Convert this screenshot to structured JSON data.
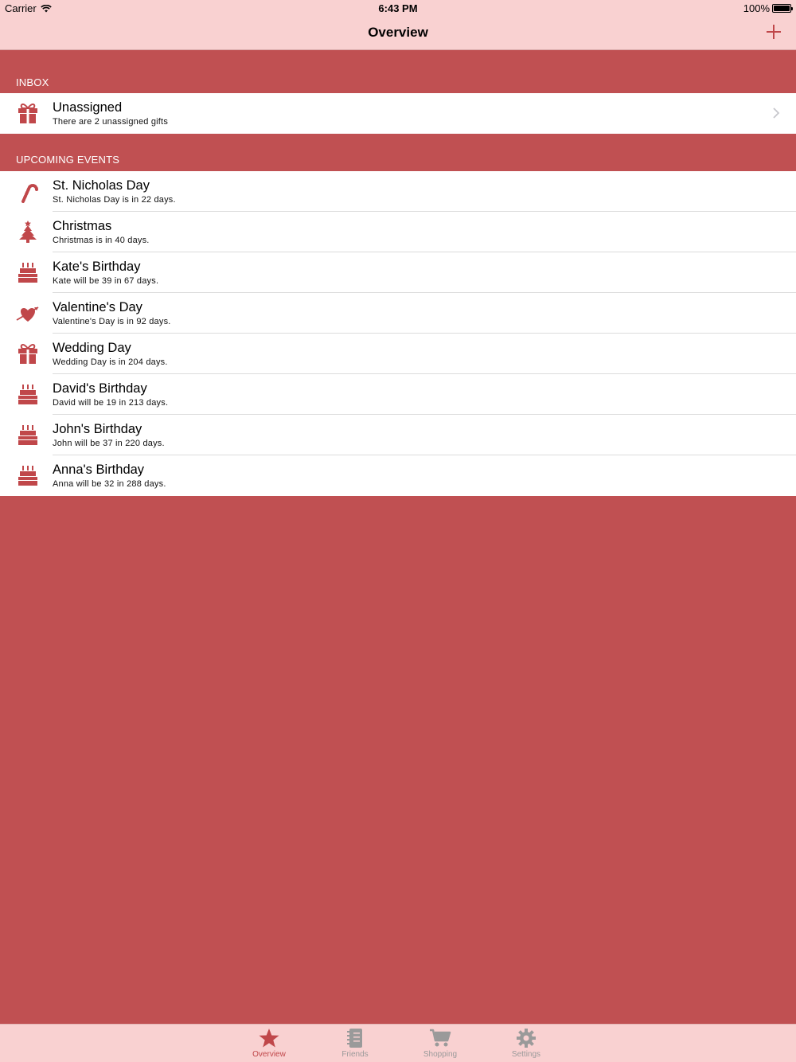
{
  "status_bar": {
    "carrier": "Carrier",
    "time": "6:43 PM",
    "battery": "100%"
  },
  "nav": {
    "title": "Overview",
    "add_icon": "plus-icon"
  },
  "inbox": {
    "header": "INBOX",
    "items": [
      {
        "icon": "gift-icon",
        "title": "Unassigned",
        "subtitle": "There are 2 unassigned gifts"
      }
    ]
  },
  "upcoming": {
    "header": "UPCOMING EVENTS",
    "items": [
      {
        "icon": "candy-cane-icon",
        "title": "St. Nicholas Day",
        "subtitle": "St. Nicholas Day is in 22 days."
      },
      {
        "icon": "christmas-tree-icon",
        "title": "Christmas",
        "subtitle": "Christmas is in 40 days."
      },
      {
        "icon": "birthday-cake-icon",
        "title": "Kate's Birthday",
        "subtitle": "Kate will be 39 in 67 days."
      },
      {
        "icon": "heart-arrow-icon",
        "title": "Valentine's Day",
        "subtitle": "Valentine's Day is in 92 days."
      },
      {
        "icon": "gift-icon",
        "title": "Wedding Day",
        "subtitle": "Wedding Day is in 204 days."
      },
      {
        "icon": "birthday-cake-icon",
        "title": "David's Birthday",
        "subtitle": "David will be 19 in 213 days."
      },
      {
        "icon": "birthday-cake-icon",
        "title": "John's Birthday",
        "subtitle": "John will be 37 in 220 days."
      },
      {
        "icon": "birthday-cake-icon",
        "title": "Anna's Birthday",
        "subtitle": "Anna will be 32 in 288 days."
      }
    ]
  },
  "tabs": [
    {
      "label": "Overview",
      "icon": "star-icon",
      "active": true
    },
    {
      "label": "Friends",
      "icon": "address-book-icon",
      "active": false
    },
    {
      "label": "Shopping",
      "icon": "cart-icon",
      "active": false
    },
    {
      "label": "Settings",
      "icon": "gear-icon",
      "active": false
    }
  ],
  "colors": {
    "accent": "#c05052",
    "bar": "#f9d1d1",
    "icon": "#c0474a",
    "tab_inactive": "#9a9a9a"
  }
}
